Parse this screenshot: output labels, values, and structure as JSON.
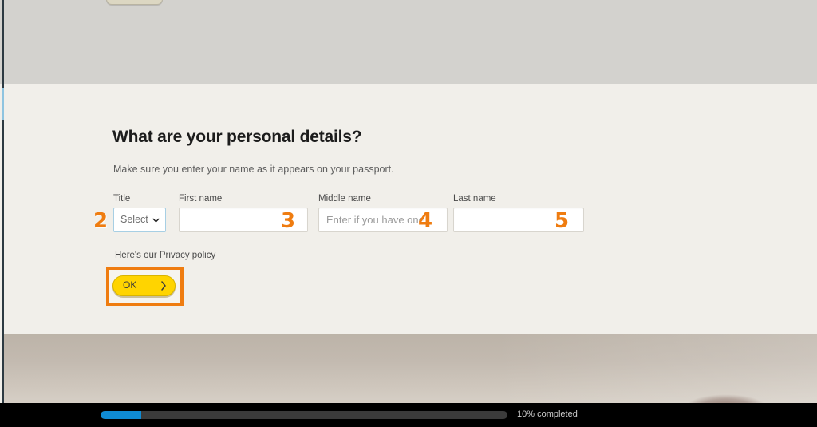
{
  "page": {
    "title": "What are your personal details?",
    "subtitle": "Make sure you enter your name as it appears on your passport."
  },
  "form": {
    "title_field": {
      "label": "Title",
      "value": "Select",
      "caret_icon": "chevron-down-icon",
      "options": [
        "Select"
      ]
    },
    "first_name": {
      "label": "First name",
      "value": "",
      "placeholder": ""
    },
    "middle_name": {
      "label": "Middle name",
      "value": "",
      "placeholder": "Enter if you have one"
    },
    "last_name": {
      "label": "Last name",
      "value": "",
      "placeholder": ""
    }
  },
  "privacy": {
    "prefix": "Here's our ",
    "link_text": "Privacy policy"
  },
  "submit": {
    "label": "OK",
    "chevron_icon": "chevron-right-icon"
  },
  "markers": {
    "title": "2",
    "first_name": "3",
    "middle_name": "4",
    "last_name": "5"
  },
  "progress": {
    "text": "10% completed",
    "percent": 10,
    "fill_color": "#0f8bd4",
    "track_color": "#3b3b3b"
  },
  "colors": {
    "accent_highlight": "#ef7c10",
    "button_yellow": "#ffd400",
    "page_background": "#f1efea",
    "top_band": "#d3d2ce"
  }
}
